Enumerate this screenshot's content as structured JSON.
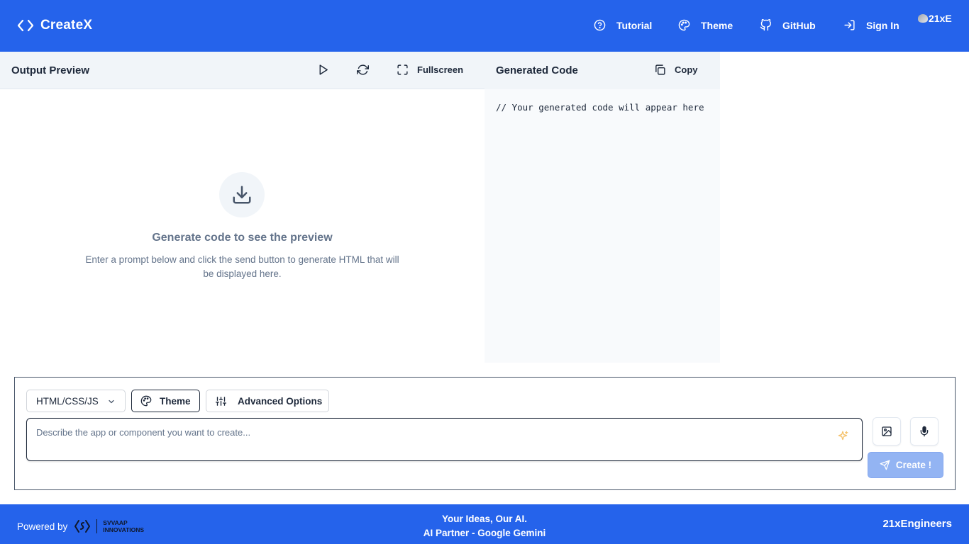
{
  "header": {
    "brand": "CreateX",
    "nav": {
      "tutorial": "Tutorial",
      "theme": "Theme",
      "github": "GitHub",
      "sign_in": "Sign In"
    },
    "avatar_alt": "21xE"
  },
  "preview": {
    "title": "Output Preview",
    "fullscreen_label": "Fullscreen",
    "empty_title": "Generate code to see the preview",
    "empty_desc": "Enter a prompt below and click the send button to generate HTML that will be displayed here."
  },
  "code": {
    "title": "Generated Code",
    "copy_label": "Copy",
    "placeholder": "// Your generated code will appear here"
  },
  "prompt": {
    "language": "HTML/CSS/JS",
    "theme_label": "Theme",
    "advanced_label": "Advanced Options",
    "placeholder": "Describe the app or component you want to create...",
    "create_label": "Create !"
  },
  "footer": {
    "powered_by": "Powered by",
    "partner_line1": "SVVAAP",
    "partner_line2": "INNOVATIONS",
    "tagline": "Your Ideas, Our AI.",
    "ai_partner": "AI Partner - Google Gemini",
    "right": "21xEngineers"
  },
  "colors": {
    "primary": "#2563eb",
    "panel_bg": "#f1f5f9",
    "create_disabled": "#93b4f3",
    "sparkle": "#f5c26b"
  }
}
